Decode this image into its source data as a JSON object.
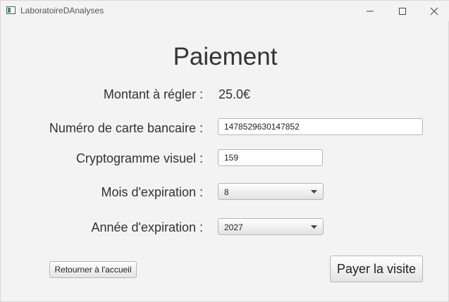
{
  "window": {
    "title": "LaboratoireDAnalyses"
  },
  "page": {
    "heading": "Paiement"
  },
  "form": {
    "amount_label": "Montant à régler :",
    "amount_value": "25.0€",
    "card_number_label": "Numéro de carte bancaire :",
    "card_number_value": "1478529630147852",
    "cvv_label": "Cryptogramme visuel :",
    "cvv_value": "159",
    "exp_month_label": "Mois d'expiration :",
    "exp_month_value": "8",
    "exp_year_label": "Année d'expiration :",
    "exp_year_value": "2027"
  },
  "actions": {
    "home_label": "Retourner à l'accueil",
    "pay_label": "Payer la visite"
  },
  "icons": {
    "app": "app-window-icon",
    "minimize": "minimize-icon",
    "maximize": "maximize-icon",
    "close": "close-icon",
    "dropdown": "chevron-down-icon"
  }
}
